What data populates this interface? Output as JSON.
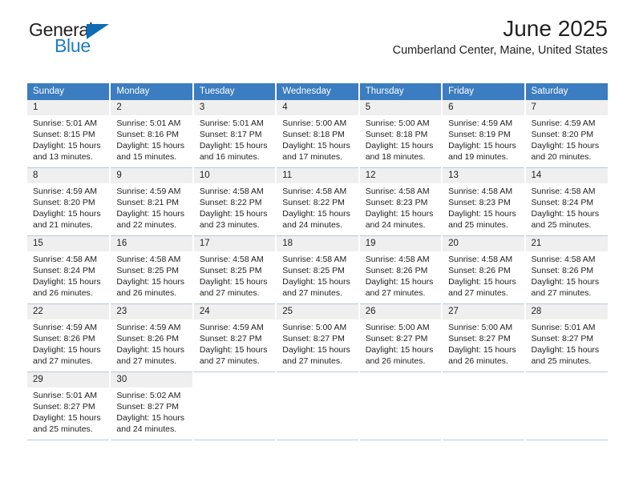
{
  "brand": {
    "name_top": "General",
    "name_bottom": "Blue",
    "accent_color": "#1d7cc4",
    "triangle_color": "#0f6cb5"
  },
  "header": {
    "title": "June 2025",
    "location": "Cumberland Center, Maine, United States"
  },
  "calendar": {
    "header_bg": "#3b7dc0",
    "daynum_bg": "#efefef",
    "weekdays": [
      "Sunday",
      "Monday",
      "Tuesday",
      "Wednesday",
      "Thursday",
      "Friday",
      "Saturday"
    ],
    "labels": {
      "sunrise": "Sunrise:",
      "sunset": "Sunset:",
      "daylight": "Daylight:"
    },
    "weeks": [
      [
        {
          "day": "1",
          "sunrise": "Sunrise: 5:01 AM",
          "sunset": "Sunset: 8:15 PM",
          "daylight_line1": "Daylight: 15 hours",
          "daylight_line2": "and 13 minutes."
        },
        {
          "day": "2",
          "sunrise": "Sunrise: 5:01 AM",
          "sunset": "Sunset: 8:16 PM",
          "daylight_line1": "Daylight: 15 hours",
          "daylight_line2": "and 15 minutes."
        },
        {
          "day": "3",
          "sunrise": "Sunrise: 5:01 AM",
          "sunset": "Sunset: 8:17 PM",
          "daylight_line1": "Daylight: 15 hours",
          "daylight_line2": "and 16 minutes."
        },
        {
          "day": "4",
          "sunrise": "Sunrise: 5:00 AM",
          "sunset": "Sunset: 8:18 PM",
          "daylight_line1": "Daylight: 15 hours",
          "daylight_line2": "and 17 minutes."
        },
        {
          "day": "5",
          "sunrise": "Sunrise: 5:00 AM",
          "sunset": "Sunset: 8:18 PM",
          "daylight_line1": "Daylight: 15 hours",
          "daylight_line2": "and 18 minutes."
        },
        {
          "day": "6",
          "sunrise": "Sunrise: 4:59 AM",
          "sunset": "Sunset: 8:19 PM",
          "daylight_line1": "Daylight: 15 hours",
          "daylight_line2": "and 19 minutes."
        },
        {
          "day": "7",
          "sunrise": "Sunrise: 4:59 AM",
          "sunset": "Sunset: 8:20 PM",
          "daylight_line1": "Daylight: 15 hours",
          "daylight_line2": "and 20 minutes."
        }
      ],
      [
        {
          "day": "8",
          "sunrise": "Sunrise: 4:59 AM",
          "sunset": "Sunset: 8:20 PM",
          "daylight_line1": "Daylight: 15 hours",
          "daylight_line2": "and 21 minutes."
        },
        {
          "day": "9",
          "sunrise": "Sunrise: 4:59 AM",
          "sunset": "Sunset: 8:21 PM",
          "daylight_line1": "Daylight: 15 hours",
          "daylight_line2": "and 22 minutes."
        },
        {
          "day": "10",
          "sunrise": "Sunrise: 4:58 AM",
          "sunset": "Sunset: 8:22 PM",
          "daylight_line1": "Daylight: 15 hours",
          "daylight_line2": "and 23 minutes."
        },
        {
          "day": "11",
          "sunrise": "Sunrise: 4:58 AM",
          "sunset": "Sunset: 8:22 PM",
          "daylight_line1": "Daylight: 15 hours",
          "daylight_line2": "and 24 minutes."
        },
        {
          "day": "12",
          "sunrise": "Sunrise: 4:58 AM",
          "sunset": "Sunset: 8:23 PM",
          "daylight_line1": "Daylight: 15 hours",
          "daylight_line2": "and 24 minutes."
        },
        {
          "day": "13",
          "sunrise": "Sunrise: 4:58 AM",
          "sunset": "Sunset: 8:23 PM",
          "daylight_line1": "Daylight: 15 hours",
          "daylight_line2": "and 25 minutes."
        },
        {
          "day": "14",
          "sunrise": "Sunrise: 4:58 AM",
          "sunset": "Sunset: 8:24 PM",
          "daylight_line1": "Daylight: 15 hours",
          "daylight_line2": "and 25 minutes."
        }
      ],
      [
        {
          "day": "15",
          "sunrise": "Sunrise: 4:58 AM",
          "sunset": "Sunset: 8:24 PM",
          "daylight_line1": "Daylight: 15 hours",
          "daylight_line2": "and 26 minutes."
        },
        {
          "day": "16",
          "sunrise": "Sunrise: 4:58 AM",
          "sunset": "Sunset: 8:25 PM",
          "daylight_line1": "Daylight: 15 hours",
          "daylight_line2": "and 26 minutes."
        },
        {
          "day": "17",
          "sunrise": "Sunrise: 4:58 AM",
          "sunset": "Sunset: 8:25 PM",
          "daylight_line1": "Daylight: 15 hours",
          "daylight_line2": "and 27 minutes."
        },
        {
          "day": "18",
          "sunrise": "Sunrise: 4:58 AM",
          "sunset": "Sunset: 8:25 PM",
          "daylight_line1": "Daylight: 15 hours",
          "daylight_line2": "and 27 minutes."
        },
        {
          "day": "19",
          "sunrise": "Sunrise: 4:58 AM",
          "sunset": "Sunset: 8:26 PM",
          "daylight_line1": "Daylight: 15 hours",
          "daylight_line2": "and 27 minutes."
        },
        {
          "day": "20",
          "sunrise": "Sunrise: 4:58 AM",
          "sunset": "Sunset: 8:26 PM",
          "daylight_line1": "Daylight: 15 hours",
          "daylight_line2": "and 27 minutes."
        },
        {
          "day": "21",
          "sunrise": "Sunrise: 4:58 AM",
          "sunset": "Sunset: 8:26 PM",
          "daylight_line1": "Daylight: 15 hours",
          "daylight_line2": "and 27 minutes."
        }
      ],
      [
        {
          "day": "22",
          "sunrise": "Sunrise: 4:59 AM",
          "sunset": "Sunset: 8:26 PM",
          "daylight_line1": "Daylight: 15 hours",
          "daylight_line2": "and 27 minutes."
        },
        {
          "day": "23",
          "sunrise": "Sunrise: 4:59 AM",
          "sunset": "Sunset: 8:26 PM",
          "daylight_line1": "Daylight: 15 hours",
          "daylight_line2": "and 27 minutes."
        },
        {
          "day": "24",
          "sunrise": "Sunrise: 4:59 AM",
          "sunset": "Sunset: 8:27 PM",
          "daylight_line1": "Daylight: 15 hours",
          "daylight_line2": "and 27 minutes."
        },
        {
          "day": "25",
          "sunrise": "Sunrise: 5:00 AM",
          "sunset": "Sunset: 8:27 PM",
          "daylight_line1": "Daylight: 15 hours",
          "daylight_line2": "and 27 minutes."
        },
        {
          "day": "26",
          "sunrise": "Sunrise: 5:00 AM",
          "sunset": "Sunset: 8:27 PM",
          "daylight_line1": "Daylight: 15 hours",
          "daylight_line2": "and 26 minutes."
        },
        {
          "day": "27",
          "sunrise": "Sunrise: 5:00 AM",
          "sunset": "Sunset: 8:27 PM",
          "daylight_line1": "Daylight: 15 hours",
          "daylight_line2": "and 26 minutes."
        },
        {
          "day": "28",
          "sunrise": "Sunrise: 5:01 AM",
          "sunset": "Sunset: 8:27 PM",
          "daylight_line1": "Daylight: 15 hours",
          "daylight_line2": "and 25 minutes."
        }
      ],
      [
        {
          "day": "29",
          "sunrise": "Sunrise: 5:01 AM",
          "sunset": "Sunset: 8:27 PM",
          "daylight_line1": "Daylight: 15 hours",
          "daylight_line2": "and 25 minutes."
        },
        {
          "day": "30",
          "sunrise": "Sunrise: 5:02 AM",
          "sunset": "Sunset: 8:27 PM",
          "daylight_line1": "Daylight: 15 hours",
          "daylight_line2": "and 24 minutes."
        },
        {
          "day": "",
          "sunrise": "",
          "sunset": "",
          "daylight_line1": "",
          "daylight_line2": ""
        },
        {
          "day": "",
          "sunrise": "",
          "sunset": "",
          "daylight_line1": "",
          "daylight_line2": ""
        },
        {
          "day": "",
          "sunrise": "",
          "sunset": "",
          "daylight_line1": "",
          "daylight_line2": ""
        },
        {
          "day": "",
          "sunrise": "",
          "sunset": "",
          "daylight_line1": "",
          "daylight_line2": ""
        },
        {
          "day": "",
          "sunrise": "",
          "sunset": "",
          "daylight_line1": "",
          "daylight_line2": ""
        }
      ]
    ]
  }
}
